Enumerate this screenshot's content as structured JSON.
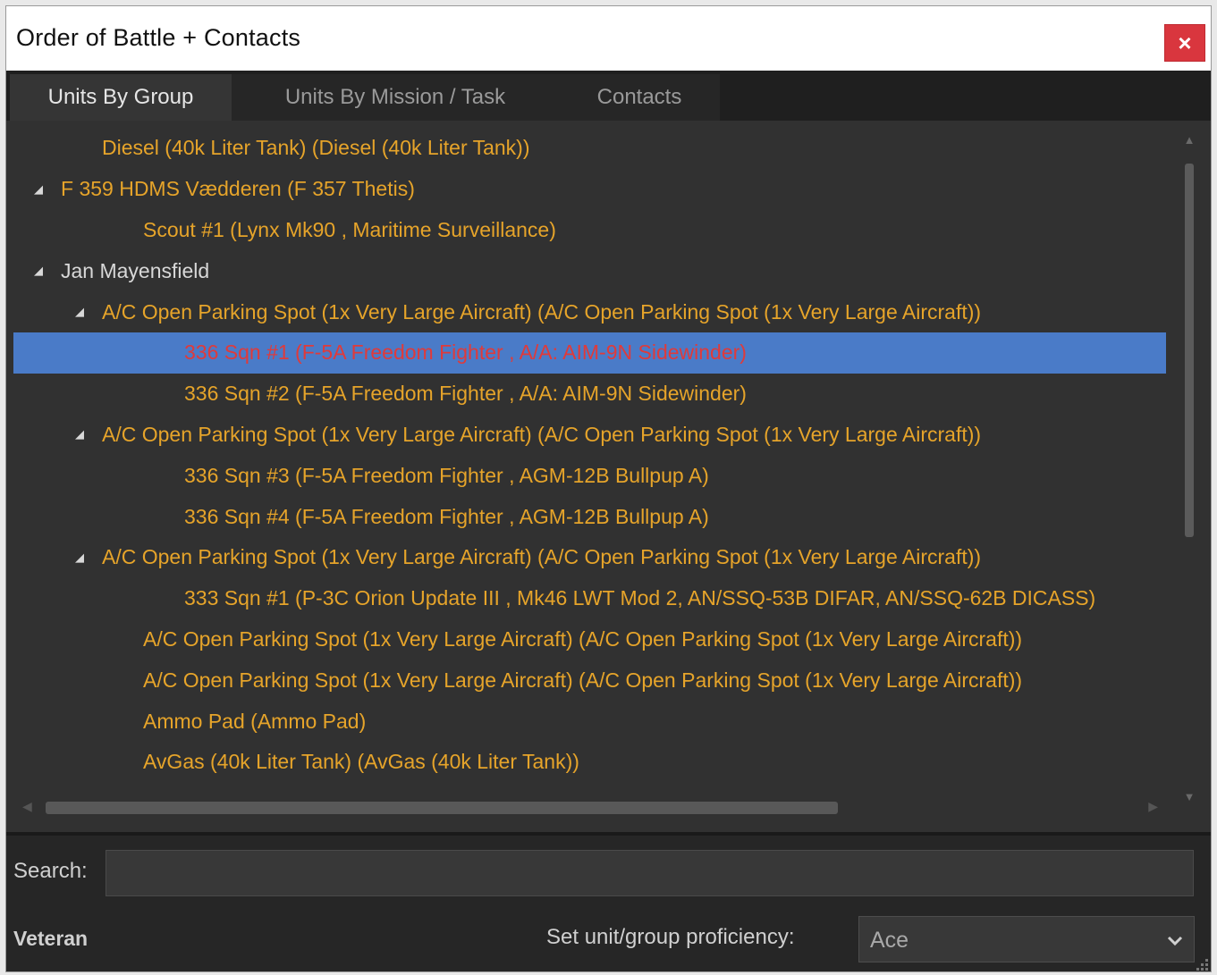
{
  "window": {
    "title": "Order of Battle + Contacts",
    "close_label": "×"
  },
  "tabs": [
    {
      "label": "Units By Group",
      "active": true
    },
    {
      "label": "Units By Mission / Task",
      "active": false
    },
    {
      "label": "Contacts",
      "active": false
    }
  ],
  "tree": {
    "expand_glyph": "◢",
    "rows": [
      {
        "level": 1,
        "expander": false,
        "text": "Diesel (40k Liter Tank) (Diesel (40k Liter Tank))",
        "color": "orange",
        "selected": false
      },
      {
        "level": 0,
        "expander": true,
        "text": "F 359 HDMS Vædderen (F 357 Thetis)",
        "color": "orange",
        "selected": false
      },
      {
        "level": 2,
        "expander": false,
        "text": "Scout #1 (Lynx Mk90 , Maritime Surveillance)",
        "color": "orange",
        "selected": false
      },
      {
        "level": 0,
        "expander": true,
        "text": "Jan Mayensfield",
        "color": "white",
        "selected": false
      },
      {
        "level": 1,
        "expander": true,
        "text": "A/C Open Parking Spot (1x Very Large Aircraft) (A/C Open Parking Spot (1x Very Large Aircraft))",
        "color": "orange",
        "selected": false
      },
      {
        "level": 3,
        "expander": false,
        "text": "336 Sqn #1 (F-5A Freedom Fighter , A/A: AIM-9N Sidewinder)",
        "color": "red",
        "selected": true
      },
      {
        "level": 3,
        "expander": false,
        "text": "336 Sqn #2 (F-5A Freedom Fighter , A/A: AIM-9N Sidewinder)",
        "color": "orange",
        "selected": false
      },
      {
        "level": 1,
        "expander": true,
        "text": "A/C Open Parking Spot (1x Very Large Aircraft) (A/C Open Parking Spot (1x Very Large Aircraft))",
        "color": "orange",
        "selected": false
      },
      {
        "level": 3,
        "expander": false,
        "text": "336 Sqn #3 (F-5A Freedom Fighter , AGM-12B Bullpup A)",
        "color": "orange",
        "selected": false
      },
      {
        "level": 3,
        "expander": false,
        "text": "336 Sqn #4 (F-5A Freedom Fighter , AGM-12B Bullpup A)",
        "color": "orange",
        "selected": false
      },
      {
        "level": 1,
        "expander": true,
        "text": "A/C Open Parking Spot (1x Very Large Aircraft) (A/C Open Parking Spot (1x Very Large Aircraft))",
        "color": "orange",
        "selected": false
      },
      {
        "level": 3,
        "expander": false,
        "text": "333 Sqn #1 (P-3C Orion Update III , Mk46 LWT Mod 2, AN/SSQ-53B DIFAR, AN/SSQ-62B DICASS)",
        "color": "orange",
        "selected": false
      },
      {
        "level": 2,
        "expander": false,
        "text": "A/C Open Parking Spot (1x Very Large Aircraft) (A/C Open Parking Spot (1x Very Large Aircraft))",
        "color": "orange",
        "selected": false
      },
      {
        "level": 2,
        "expander": false,
        "text": "A/C Open Parking Spot (1x Very Large Aircraft) (A/C Open Parking Spot (1x Very Large Aircraft))",
        "color": "orange",
        "selected": false
      },
      {
        "level": 2,
        "expander": false,
        "text": "Ammo Pad (Ammo Pad)",
        "color": "orange",
        "selected": false
      },
      {
        "level": 2,
        "expander": false,
        "text": "AvGas (40k Liter Tank) (AvGas (40k Liter Tank))",
        "color": "orange",
        "selected": false
      }
    ]
  },
  "search": {
    "label": "Search:",
    "value": "",
    "placeholder": ""
  },
  "proficiency": {
    "current": "Veteran",
    "label": "Set unit/group proficiency:",
    "selected": "Ace"
  },
  "colors": {
    "orange": "#e6a42a",
    "white": "#d8d8d8",
    "red": "#e03a3a",
    "selection": "#4a7bc8"
  }
}
